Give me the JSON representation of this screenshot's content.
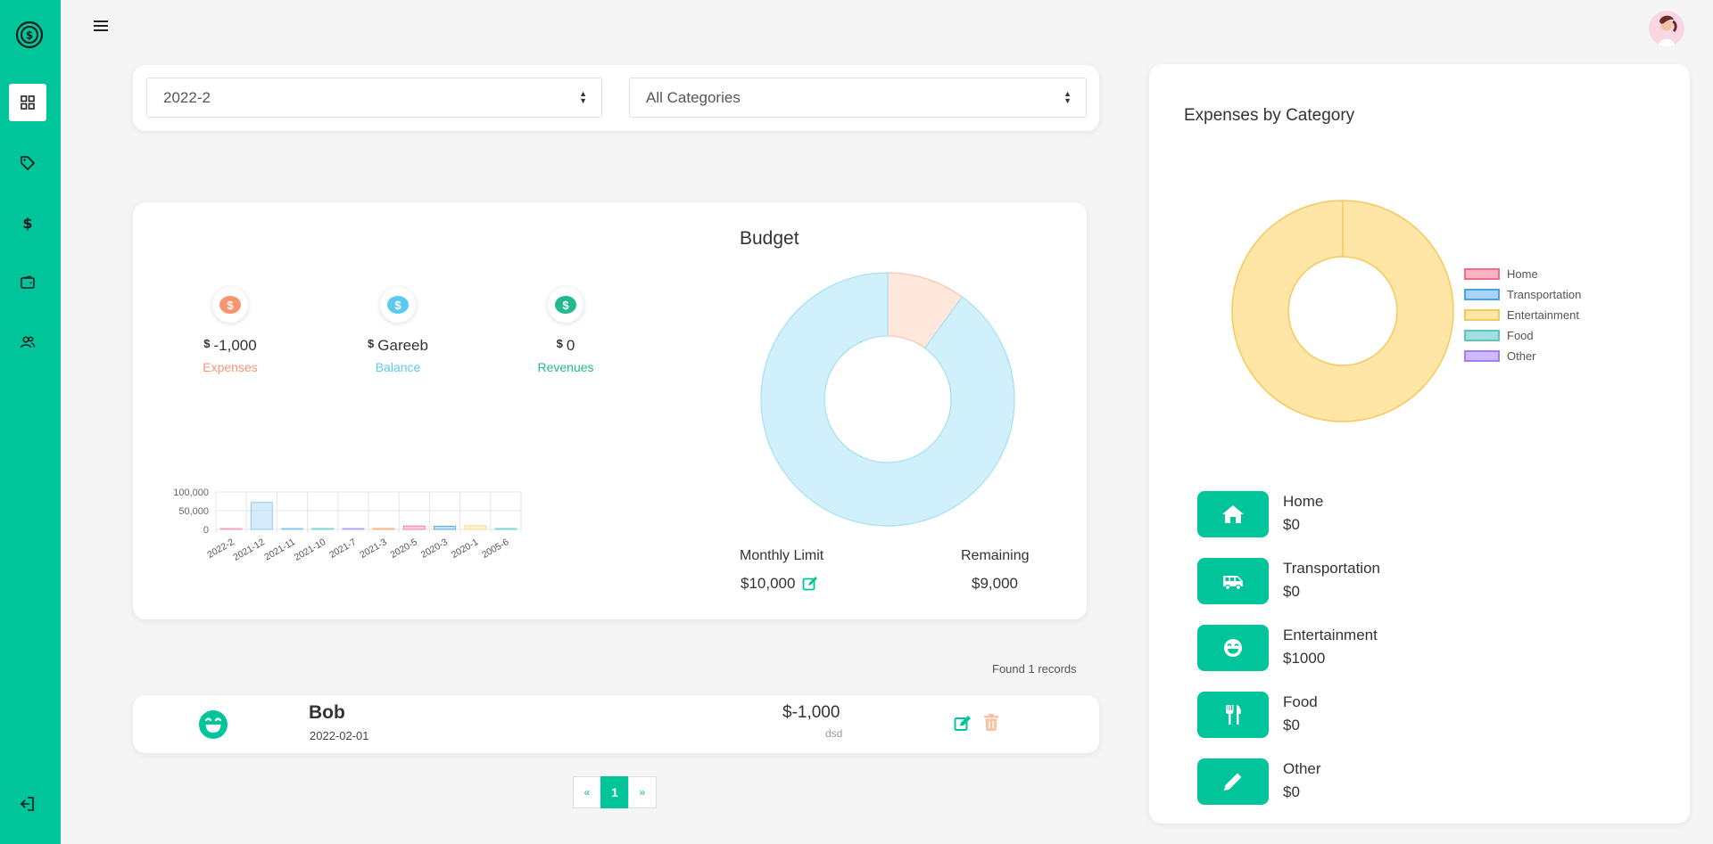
{
  "filters": {
    "period_selected": "2022-2",
    "category_selected": "All Categories"
  },
  "stats": {
    "currency_symbol": "$",
    "expenses": {
      "value": "-1,000",
      "label": "Expenses",
      "color": "#f8956f"
    },
    "balance": {
      "value": "Gareeb",
      "label": "Balance",
      "color": "#5ccaf0"
    },
    "revenues": {
      "value": "0",
      "label": "Revenues",
      "color": "#22b98f"
    }
  },
  "budget": {
    "title": "Budget",
    "monthly_limit_label": "Monthly Limit",
    "monthly_limit_value": "$10,000",
    "remaining_label": "Remaining",
    "remaining_value": "$9,000"
  },
  "chart_data": [
    {
      "type": "bar",
      "categories": [
        "2022-2",
        "2021-12",
        "2021-11",
        "2021-10",
        "2021-7",
        "2021-3",
        "2020-5",
        "2020-3",
        "2020-1",
        "2005-6"
      ],
      "values": [
        500,
        72000,
        0,
        1000,
        1500,
        2500,
        9000,
        8500,
        10000,
        1000
      ],
      "colors": [
        "#f8a3b4",
        "#8cc9f2",
        "#8cc9f2",
        "#7fd4d0",
        "#b8a3f5",
        "#f8b47f",
        "#f77f9a",
        "#5ca9e6",
        "#ffd98a",
        "#7fd4d0"
      ],
      "yticks": [
        "100,000",
        "50,000",
        "0"
      ],
      "ylim": [
        0,
        100000
      ]
    },
    {
      "type": "pie",
      "labels": [
        "Expenses",
        "Remaining"
      ],
      "values": [
        1000,
        9000
      ],
      "colors": [
        "#ffe7db",
        "#d0f1fb"
      ],
      "borders": [
        "#f9c8b0",
        "#a8e0f3"
      ]
    },
    {
      "type": "pie",
      "title": "Expenses by Category",
      "labels": [
        "Home",
        "Transportation",
        "Entertainment",
        "Food",
        "Other"
      ],
      "values": [
        0,
        0,
        1000,
        0,
        0
      ],
      "colors": [
        "#ffb3c3",
        "#a8d4f7",
        "#ffe6a6",
        "#a3dede",
        "#cfb8fb"
      ],
      "borders": [
        "#f26b8a",
        "#4aa3e6",
        "#f6c85b",
        "#5ec3c3",
        "#a17ef5"
      ],
      "legend": "right"
    }
  ],
  "records": {
    "found_text": "Found 1 records",
    "items": [
      {
        "name": "Bob",
        "date": "2022-02-01",
        "amount": "$-1,000",
        "note": "dsd",
        "icon": "smile-icon"
      }
    ]
  },
  "pagination": {
    "prev": "«",
    "current": "1",
    "next": "»"
  },
  "categories": [
    {
      "name": "Home",
      "amount": "$0",
      "icon": "home-icon"
    },
    {
      "name": "Transportation",
      "amount": "$0",
      "icon": "bus-icon"
    },
    {
      "name": "Entertainment",
      "amount": "$1000",
      "icon": "smile-icon"
    },
    {
      "name": "Food",
      "amount": "$0",
      "icon": "utensils-icon"
    },
    {
      "name": "Other",
      "amount": "$0",
      "icon": "pencil-icon"
    }
  ],
  "theme": {
    "accent": "#00c49a"
  }
}
